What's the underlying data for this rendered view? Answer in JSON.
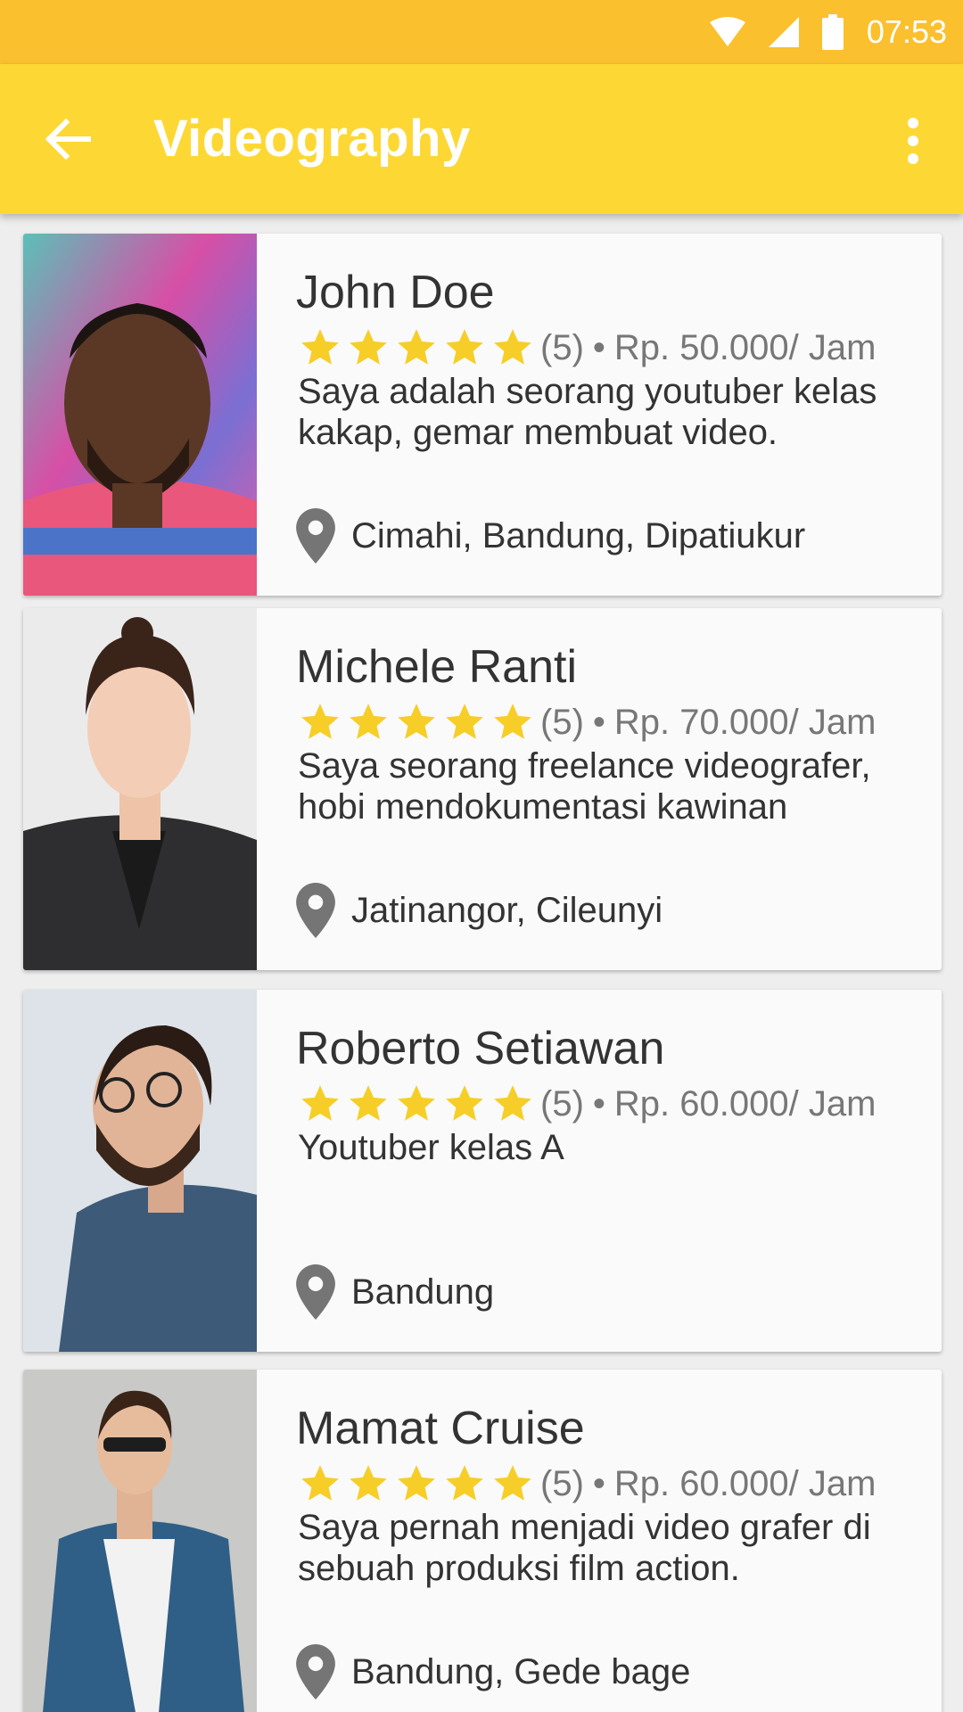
{
  "status_bar": {
    "time": "07:53"
  },
  "app_bar": {
    "title": "Videography"
  },
  "colors": {
    "status_bar": "#FBC02D",
    "app_bar": "#FDD835",
    "star": "#F6CE27",
    "pin": "#757575"
  },
  "providers": [
    {
      "name": "John Doe",
      "stars": 5,
      "rating_count": "(5)",
      "separator": "•",
      "price": "Rp. 50.000/ Jam",
      "description": "Saya adalah seorang youtuber kelas kakap, gemar membuat video.",
      "location": "Cimahi, Bandung, Dipatiukur"
    },
    {
      "name": "Michele Ranti",
      "stars": 5,
      "rating_count": "(5)",
      "separator": "•",
      "price": "Rp. 70.000/ Jam",
      "description": "Saya seorang freelance videografer, hobi mendokumentasi kawinan",
      "location": "Jatinangor, Cileunyi"
    },
    {
      "name": "Roberto Setiawan",
      "stars": 5,
      "rating_count": "(5)",
      "separator": "•",
      "price": "Rp. 60.000/ Jam",
      "description": "Youtuber kelas A",
      "location": "Bandung"
    },
    {
      "name": "Mamat Cruise",
      "stars": 5,
      "rating_count": "(5)",
      "separator": "•",
      "price": "Rp. 60.000/ Jam",
      "description": "Saya pernah menjadi video grafer di sebuah produksi film action.",
      "location": "Bandung, Gede bage"
    }
  ]
}
